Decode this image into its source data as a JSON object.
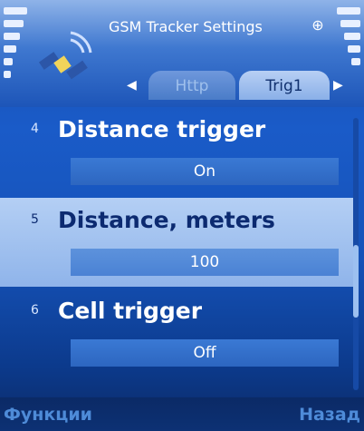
{
  "header": {
    "title": "GSM Tracker Settings",
    "app_icon": "satellite-icon",
    "gps_icon": "gps-indicator-icon"
  },
  "tabs": [
    {
      "label": "Http",
      "active": false
    },
    {
      "label": "Trig1",
      "active": true
    }
  ],
  "settings": [
    {
      "number": "4",
      "label": "Distance trigger",
      "value": "On"
    },
    {
      "number": "5",
      "label": "Distance, meters",
      "value": "100"
    },
    {
      "number": "6",
      "label": "Cell trigger",
      "value": "Off"
    }
  ],
  "softkeys": {
    "left": "Функции",
    "right": "Назад"
  },
  "colors": {
    "background": "#1a5bc8",
    "highlight": "#b4cff4",
    "value_box": "#3a79d4",
    "softkey_text": "#4e8bd8"
  }
}
